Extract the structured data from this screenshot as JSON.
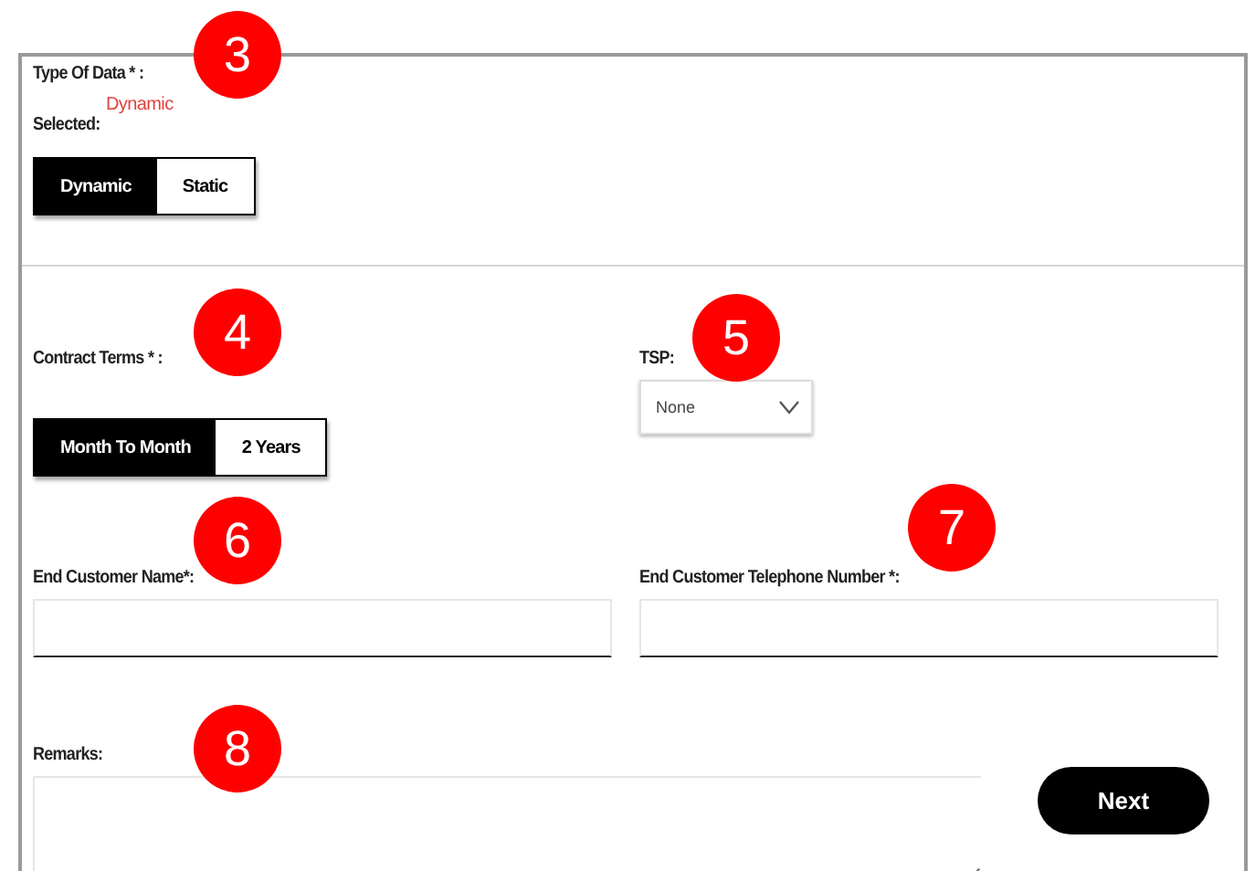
{
  "type_of_data": {
    "label": "Type Of Data * :",
    "selected_value": "Dynamic",
    "selected_label": "Selected:",
    "options": [
      {
        "label": "Dynamic",
        "selected": true
      },
      {
        "label": "Static",
        "selected": false
      }
    ]
  },
  "contract_terms": {
    "label": "Contract Terms * :",
    "options": [
      {
        "label": "Month To Month",
        "selected": true
      },
      {
        "label": "2 Years",
        "selected": false
      }
    ]
  },
  "tsp": {
    "label": "TSP:",
    "value": "None"
  },
  "end_customer_name": {
    "label": "End Customer Name*:"
  },
  "end_customer_telephone": {
    "label": "End Customer Telephone Number *:"
  },
  "remarks": {
    "label": "Remarks:"
  },
  "next_button": "Next",
  "callouts": [
    "3",
    "4",
    "5",
    "6",
    "7",
    "8"
  ]
}
